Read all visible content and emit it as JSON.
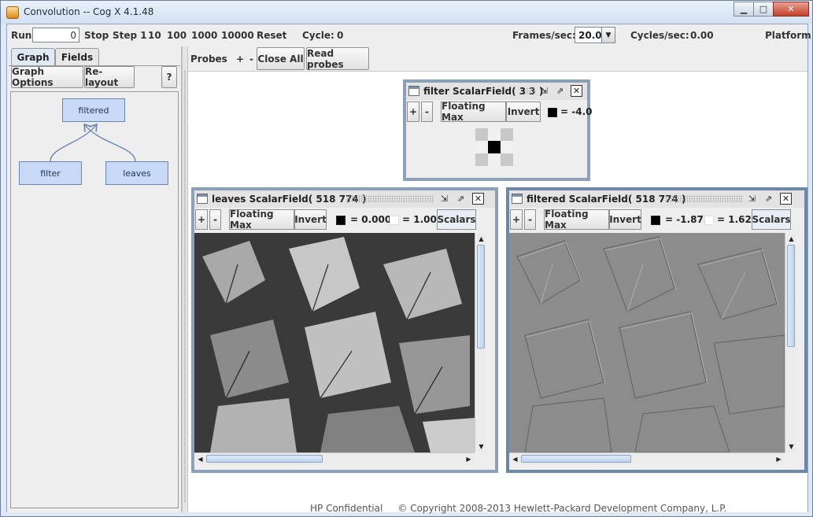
{
  "window": {
    "title": "Convolution -- Cog X 4.1.48",
    "minimize": "▁",
    "maximize": "□",
    "close": "✕"
  },
  "toolbar": {
    "run_label": "Run",
    "run_value": "0",
    "stop_label": "Stop",
    "step1_label": "Step 1",
    "step10_label": "10",
    "step100_label": "100",
    "step1000_label": "1000",
    "step10000_label": "10000",
    "reset_label": "Reset",
    "cycle_label": "Cycle:",
    "cycle_value": "0",
    "fps_label": "Frames/sec:",
    "fps_value": "20.0",
    "cps_label": "Cycles/sec:",
    "cps_value": "0.00",
    "platform_label": "Platform"
  },
  "left_panel": {
    "tabs": [
      {
        "label": "Graph",
        "active": true
      },
      {
        "label": "Fields",
        "active": false
      }
    ],
    "graph_options_label": "Graph Options",
    "relayout_label": "Re-layout",
    "help_label": "?",
    "nodes": [
      "filtered",
      "filter",
      "leaves"
    ]
  },
  "probe_bar": {
    "probes_label": "Probes",
    "plus_label": "+",
    "minus_label": "-",
    "close_all_label": "Close All",
    "read_probes_label": "Read probes"
  },
  "probes": [
    {
      "title": "filter ScalarField( 3 3 )",
      "plus": "+",
      "minus": "-",
      "floating_max": "Floating Max",
      "invert": "Invert",
      "black_eq": "= -4.0",
      "filter_kernel": [
        [
          0.25,
          0,
          0.25
        ],
        [
          0,
          -1,
          0
        ],
        [
          0.25,
          0,
          0.25
        ]
      ]
    },
    {
      "title": "leaves ScalarField( 518 774 )",
      "plus": "+",
      "minus": "-",
      "floating_max": "Floating Max",
      "invert": "Invert",
      "black_eq": "= 0.000",
      "white_eq": "= 1.000",
      "scalars": "Scalars"
    },
    {
      "title": "filtered ScalarField( 518 774 )",
      "plus": "+",
      "minus": "-",
      "floating_max": "Floating Max",
      "invert": "Invert",
      "black_eq": "= -1.875",
      "white_eq": "= 1.620",
      "scalars": "Scalars"
    }
  ],
  "footer": {
    "confidential": "HP Confidential",
    "copyright": "© Copyright 2008-2013 Hewlett-Packard Development Company, L.P."
  },
  "colors": {
    "window_frame": "#6b7f99",
    "node_fill": "#c7d9f5",
    "node_border": "#6b86b5",
    "edge": "#6b86b5",
    "close_button": "#c4412b"
  },
  "icons": [
    "app-icon",
    "minimize-icon",
    "maximize-icon",
    "close-icon",
    "dropdown-arrow-icon",
    "frame-icon",
    "iconify-icon",
    "maximize-frame-icon",
    "close-frame-icon"
  ]
}
